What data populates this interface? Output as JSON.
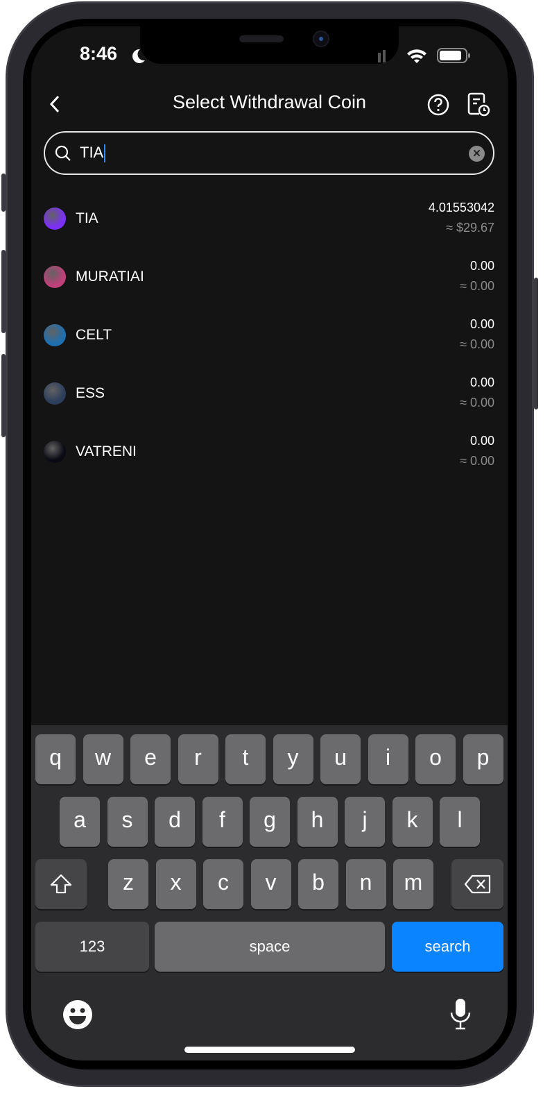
{
  "status_bar": {
    "time": "8:46"
  },
  "header": {
    "title": "Select Withdrawal Coin"
  },
  "search": {
    "value": "TIA"
  },
  "coins": [
    {
      "symbol": "TIA",
      "amount": "4.01553042",
      "value": "≈ $29.67",
      "color": "#7b2ff7"
    },
    {
      "symbol": "MURATIAI",
      "amount": "0.00",
      "value": "≈ 0.00",
      "color": "#c0407a"
    },
    {
      "symbol": "CELT",
      "amount": "0.00",
      "value": "≈ 0.00",
      "color": "#1e6fb0"
    },
    {
      "symbol": "ESS",
      "amount": "0.00",
      "value": "≈ 0.00",
      "color": "#2c3e5c"
    },
    {
      "symbol": "VATRENI",
      "amount": "0.00",
      "value": "≈ 0.00",
      "color": "#0a0a14"
    }
  ],
  "keyboard": {
    "row1": [
      "q",
      "w",
      "e",
      "r",
      "t",
      "y",
      "u",
      "i",
      "o",
      "p"
    ],
    "row2": [
      "a",
      "s",
      "d",
      "f",
      "g",
      "h",
      "j",
      "k",
      "l"
    ],
    "row3": [
      "z",
      "x",
      "c",
      "v",
      "b",
      "n",
      "m"
    ],
    "numbers": "123",
    "space": "space",
    "search": "search",
    "accent": "#0a84ff"
  }
}
